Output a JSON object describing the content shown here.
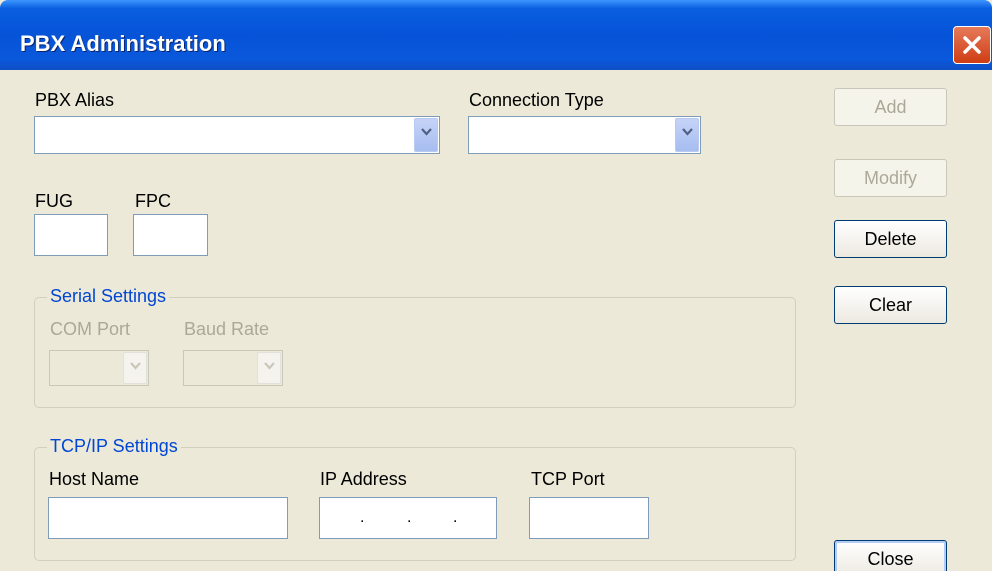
{
  "window": {
    "title": "PBX Administration"
  },
  "form": {
    "pbx_alias": {
      "label": "PBX Alias",
      "value": ""
    },
    "connection_type": {
      "label": "Connection Type",
      "value": ""
    },
    "fug": {
      "label": "FUG",
      "value": ""
    },
    "fpc": {
      "label": "FPC",
      "value": ""
    }
  },
  "serial_settings": {
    "legend": "Serial Settings",
    "com_port": {
      "label": "COM Port",
      "value": ""
    },
    "baud_rate": {
      "label": "Baud Rate",
      "value": ""
    }
  },
  "tcpip_settings": {
    "legend": "TCP/IP Settings",
    "host_name": {
      "label": "Host Name",
      "value": ""
    },
    "ip_address": {
      "label": "IP Address",
      "separators": [
        ".",
        ".",
        "."
      ]
    },
    "tcp_port": {
      "label": "TCP Port",
      "value": ""
    }
  },
  "buttons": {
    "add": "Add",
    "modify": "Modify",
    "delete": "Delete",
    "clear": "Clear",
    "close": "Close"
  },
  "icons": {
    "close": "close-icon",
    "dropdown": "chevron-down-icon"
  },
  "colors": {
    "titlebar": "#0653d8",
    "window_bg": "#ece9d8",
    "group_legend": "#0046d5",
    "disabled_text": "#aca899"
  }
}
